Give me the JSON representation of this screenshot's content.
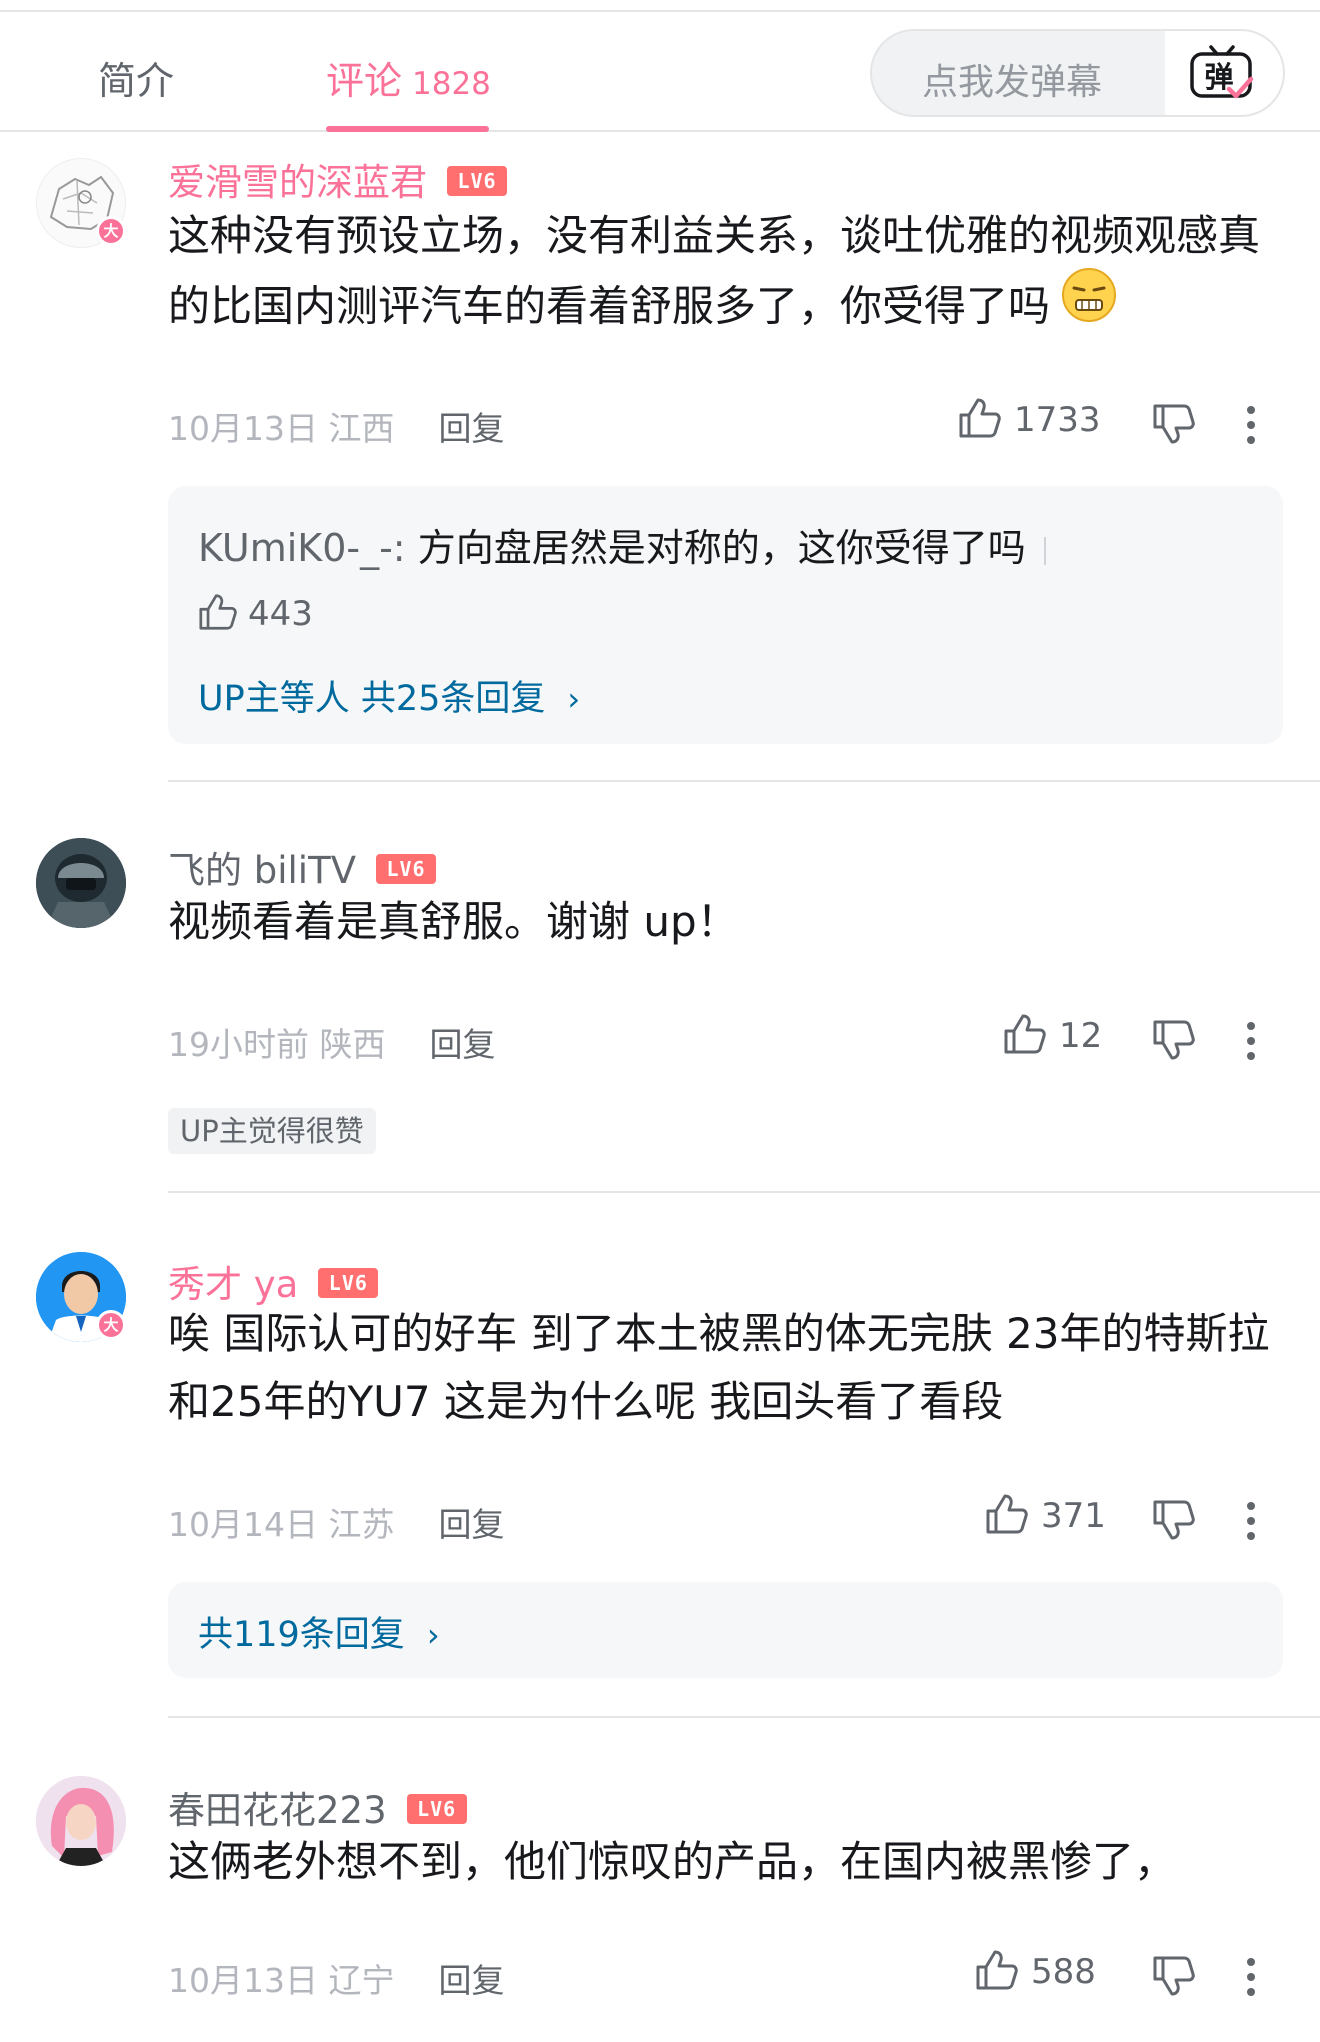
{
  "tabs": {
    "intro": "简介",
    "comments": "评论",
    "comment_count": "1828"
  },
  "danmaku": {
    "placeholder": "点我发弹幕",
    "button_glyph": "弹"
  },
  "comments": [
    {
      "username": "爱滑雪的深蓝君",
      "level": "LV6",
      "name_color": "#fb7299",
      "badge": "大",
      "text": "这种没有预设立场，没有利益关系，谈吐优雅的视频观感真的比国内测评汽车的看着舒服多了，你受得了吗",
      "emoji": "grimace-emoji",
      "time": "10月13日",
      "location": "江西",
      "reply_label": "回复",
      "likes": "1733",
      "sub_reply": {
        "user": "KUmiK0-_-:",
        "text": " 方向盘居然是对称的，这你受得了吗",
        "likes": "443"
      },
      "reply_summary": "UP主等人 共25条回复"
    },
    {
      "username": "飞的 biliTV",
      "level": "LV6",
      "name_color": "#61666d",
      "text": "视频看着是真舒服。谢谢 up！",
      "time": "19小时前",
      "location": "陕西",
      "reply_label": "回复",
      "likes": "12",
      "tag": "UP主觉得很赞"
    },
    {
      "username": "秀才 ya",
      "level": "LV6",
      "name_color": "#fb7299",
      "badge": "大",
      "text": "唉  国际认可的好车  到了本土被黑的体无完肤    23年的特斯拉和25年的YU7   这是为什么呢   我回头看了看段",
      "time": "10月14日",
      "location": "江苏",
      "reply_label": "回复",
      "likes": "371",
      "reply_summary": "共119条回复"
    },
    {
      "username": "春田花花223",
      "level": "LV6",
      "name_color": "#61666d",
      "text": "这俩老外想不到，他们惊叹的产品，在国内被黑惨了，",
      "time": "10月13日",
      "location": "辽宁",
      "reply_label": "回复",
      "likes": "588"
    }
  ],
  "colors": {
    "accent_pink": "#fb7299",
    "link_blue": "#00699d",
    "level_badge": "#ff6f6f"
  }
}
